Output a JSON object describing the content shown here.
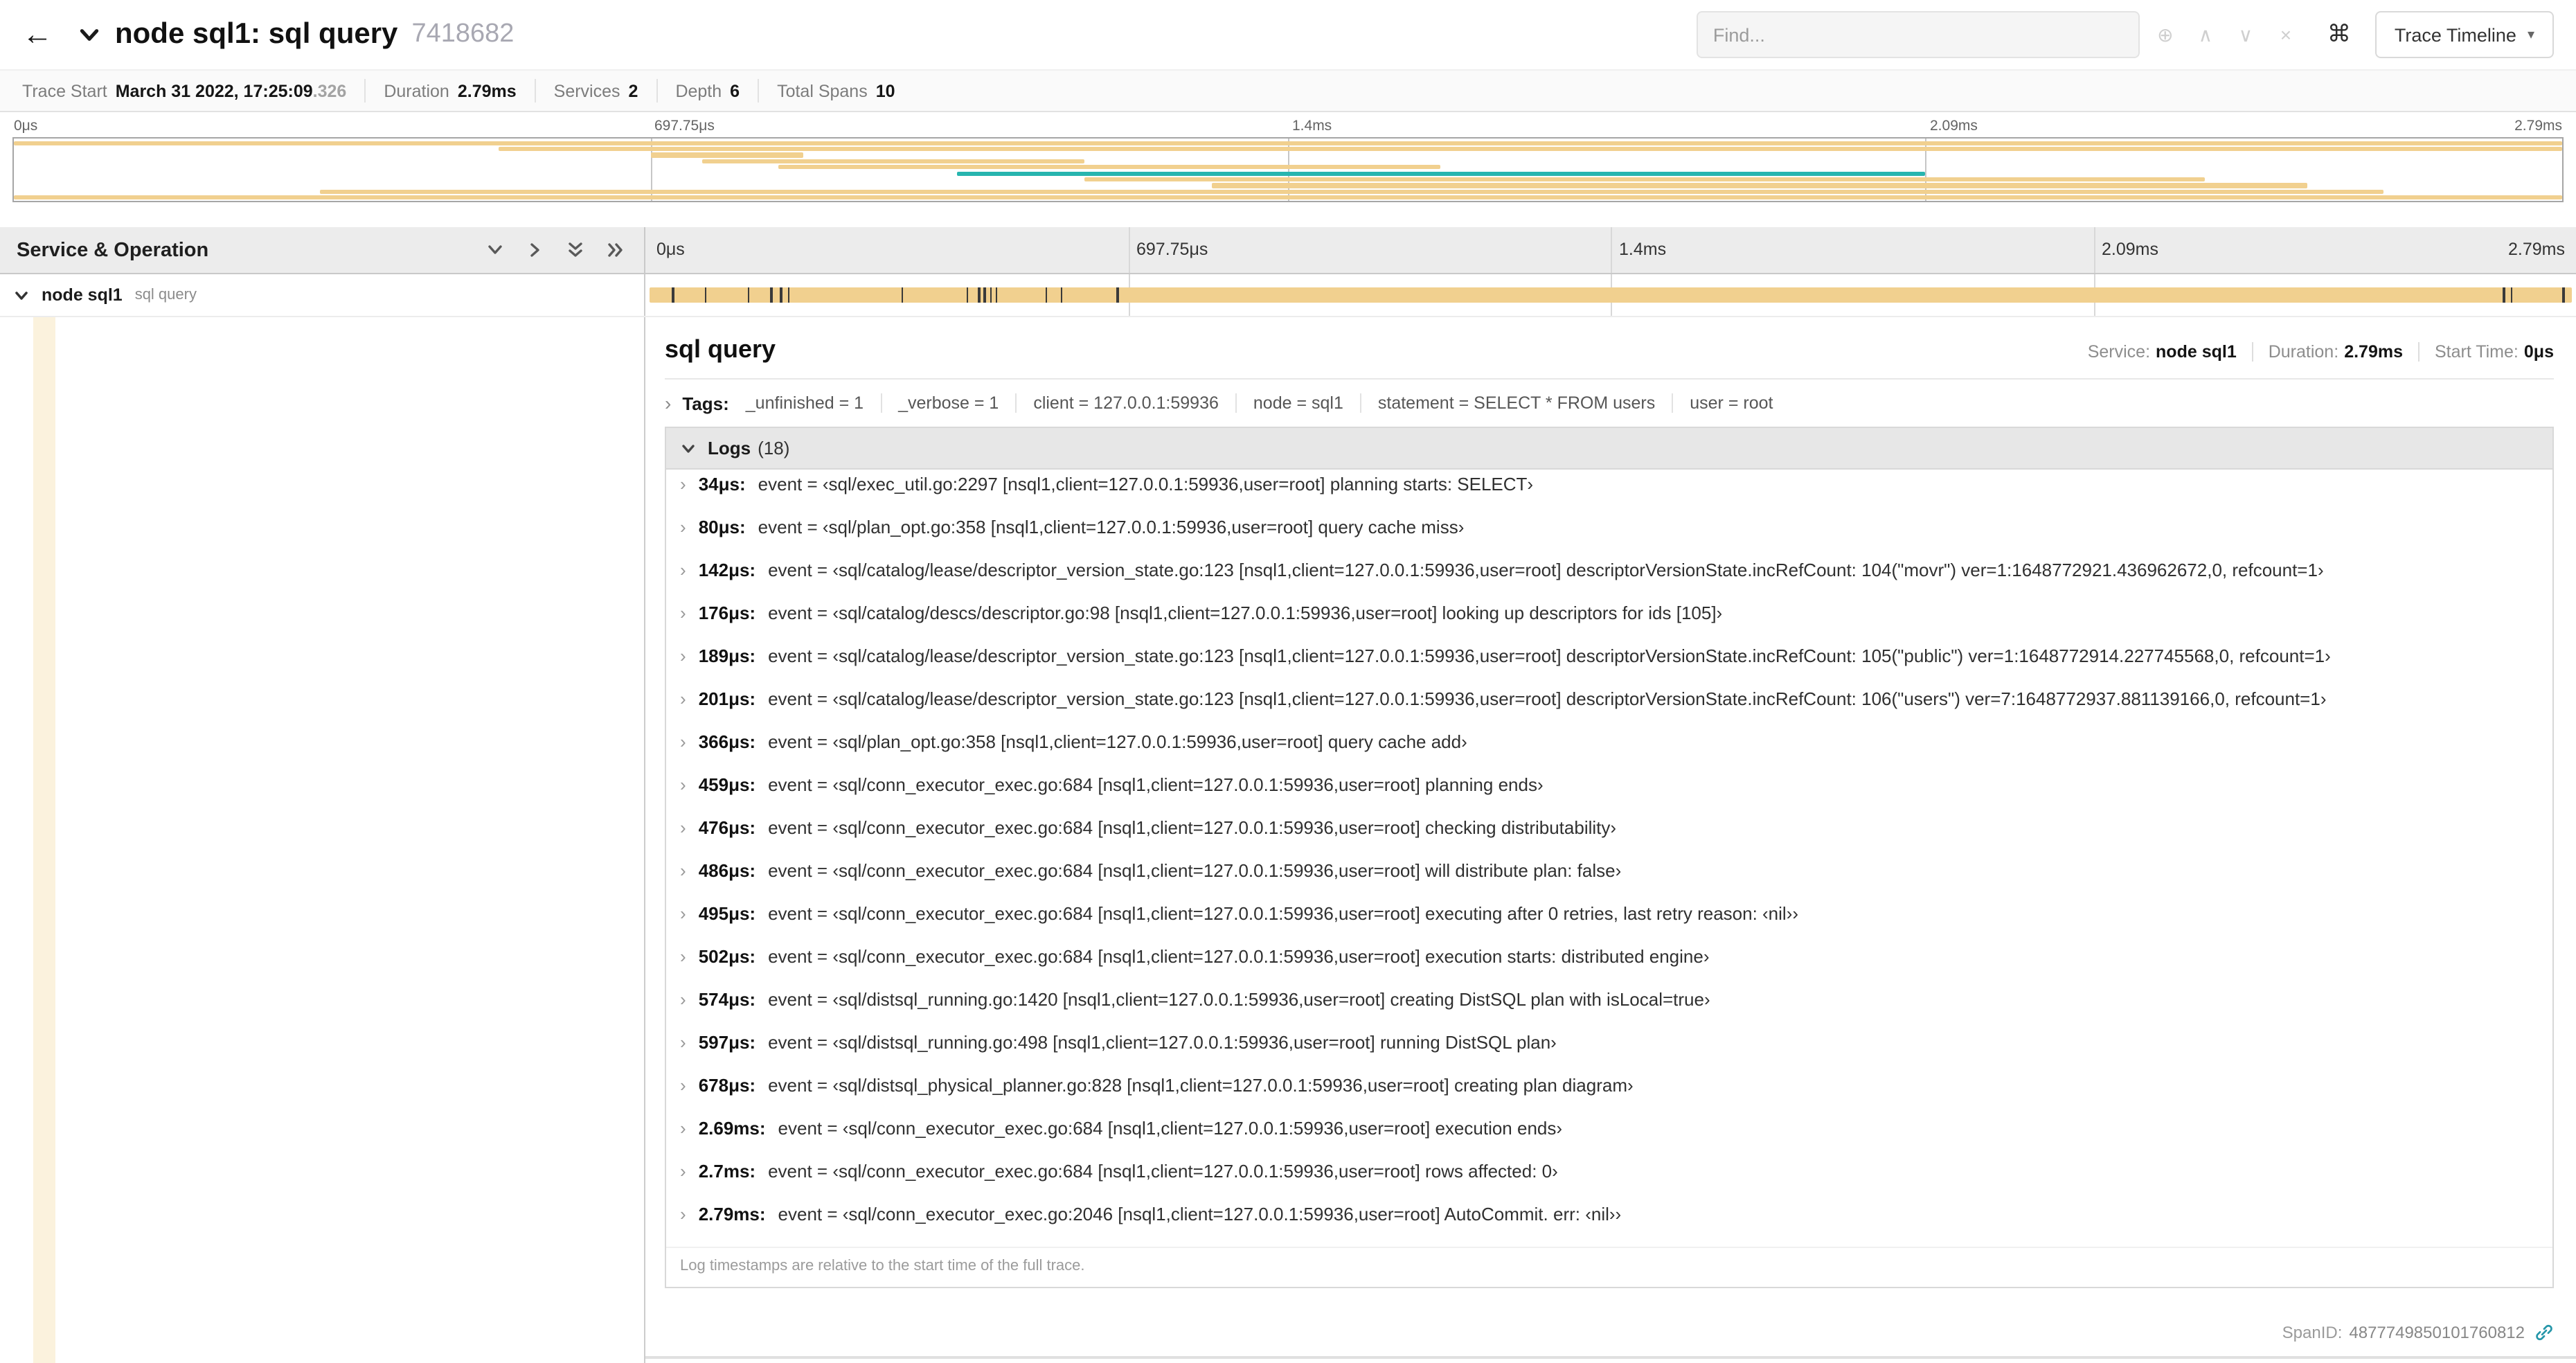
{
  "header": {
    "title": "node sql1: sql query",
    "trace_id": "7418682",
    "find_placeholder": "Find...",
    "view_button": "Trace Timeline"
  },
  "icons": {
    "back_arrow": "←",
    "zoom": "⊕",
    "prev": "∧",
    "next": "∨",
    "clear": "×",
    "command": "⌘",
    "caret_down": "▾",
    "chevron_right": "›"
  },
  "trace_info": {
    "trace_start_label": "Trace Start",
    "trace_start_value": "March 31 2022, 17:25:09",
    "trace_start_fraction": ".326",
    "duration_label": "Duration",
    "duration_value": "2.79ms",
    "services_label": "Services",
    "services_value": "2",
    "depth_label": "Depth",
    "depth_value": "6",
    "total_spans_label": "Total Spans",
    "total_spans_value": "10"
  },
  "colors": {
    "tan": "#F1D08F",
    "teal": "#27B5AF",
    "strip": "#FBF2DD"
  },
  "minimap": {
    "ticks": [
      "0μs",
      "697.75μs",
      "1.4ms",
      "2.09ms",
      "2.79ms"
    ],
    "spans": [
      {
        "row": 0,
        "start": 0,
        "end": 100,
        "color": "tan"
      },
      {
        "row": 1,
        "start": 19,
        "end": 100,
        "color": "tan"
      },
      {
        "row": 2,
        "start": 25,
        "end": 31,
        "color": "tan"
      },
      {
        "row": 3,
        "start": 27,
        "end": 42,
        "color": "tan"
      },
      {
        "row": 4,
        "start": 30,
        "end": 56,
        "color": "tan"
      },
      {
        "row": 5,
        "start": 37,
        "end": 75,
        "color": "teal"
      },
      {
        "row": 6,
        "start": 42,
        "end": 86,
        "color": "tan"
      },
      {
        "row": 7,
        "start": 47,
        "end": 90,
        "color": "tan"
      },
      {
        "row": 8,
        "start": 12,
        "end": 93,
        "color": "tan"
      },
      {
        "row": 9,
        "start": 0,
        "end": 100,
        "color": "tan"
      }
    ]
  },
  "timeline": {
    "left_header": "Service & Operation",
    "ticks": [
      "0μs",
      "697.75μs",
      "1.4ms",
      "2.09ms",
      "2.79ms"
    ],
    "row": {
      "service": "node sql1",
      "operation": "sql query",
      "bar_start": 0.2,
      "bar_end": 99.8,
      "log_ticks_pct": [
        1.2,
        2.9,
        5.1,
        6.3,
        6.8,
        7.2,
        13.1,
        16.5,
        17.1,
        17.4,
        17.7,
        18.0,
        20.6,
        21.4,
        24.3,
        96.4,
        96.8,
        99.5
      ]
    }
  },
  "detail": {
    "title": "sql query",
    "meta": {
      "service_label": "Service:",
      "service_value": "node sql1",
      "duration_label": "Duration:",
      "duration_value": "2.79ms",
      "start_label": "Start Time:",
      "start_value": "0μs"
    },
    "tags_label": "Tags:",
    "tags": [
      "_unfinished = 1",
      "_verbose = 1",
      "client = 127.0.0.1:59936",
      "node = sql1",
      "statement = SELECT * FROM users",
      "user = root"
    ],
    "logs_label": "Logs",
    "logs_count": "(18)",
    "logs": [
      {
        "time": "34μs:",
        "text": "event = ‹sql/exec_util.go:2297 [nsql1,client=127.0.0.1:59936,user=root] planning starts: SELECT›"
      },
      {
        "time": "80μs:",
        "text": "event = ‹sql/plan_opt.go:358 [nsql1,client=127.0.0.1:59936,user=root] query cache miss›"
      },
      {
        "time": "142μs:",
        "text": "event = ‹sql/catalog/lease/descriptor_version_state.go:123 [nsql1,client=127.0.0.1:59936,user=root] descriptorVersionState.incRefCount: 104(\"movr\") ver=1:1648772921.436962672,0, refcount=1›"
      },
      {
        "time": "176μs:",
        "text": "event = ‹sql/catalog/descs/descriptor.go:98 [nsql1,client=127.0.0.1:59936,user=root] looking up descriptors for ids [105]›"
      },
      {
        "time": "189μs:",
        "text": "event = ‹sql/catalog/lease/descriptor_version_state.go:123 [nsql1,client=127.0.0.1:59936,user=root] descriptorVersionState.incRefCount: 105(\"public\") ver=1:1648772914.227745568,0, refcount=1›"
      },
      {
        "time": "201μs:",
        "text": "event = ‹sql/catalog/lease/descriptor_version_state.go:123 [nsql1,client=127.0.0.1:59936,user=root] descriptorVersionState.incRefCount: 106(\"users\") ver=7:1648772937.881139166,0, refcount=1›"
      },
      {
        "time": "366μs:",
        "text": "event = ‹sql/plan_opt.go:358 [nsql1,client=127.0.0.1:59936,user=root] query cache add›"
      },
      {
        "time": "459μs:",
        "text": "event = ‹sql/conn_executor_exec.go:684 [nsql1,client=127.0.0.1:59936,user=root] planning ends›"
      },
      {
        "time": "476μs:",
        "text": "event = ‹sql/conn_executor_exec.go:684 [nsql1,client=127.0.0.1:59936,user=root] checking distributability›"
      },
      {
        "time": "486μs:",
        "text": "event = ‹sql/conn_executor_exec.go:684 [nsql1,client=127.0.0.1:59936,user=root] will distribute plan: false›"
      },
      {
        "time": "495μs:",
        "text": "event = ‹sql/conn_executor_exec.go:684 [nsql1,client=127.0.0.1:59936,user=root] executing after 0 retries, last retry reason: ‹nil››"
      },
      {
        "time": "502μs:",
        "text": "event = ‹sql/conn_executor_exec.go:684 [nsql1,client=127.0.0.1:59936,user=root] execution starts: distributed engine›"
      },
      {
        "time": "574μs:",
        "text": "event = ‹sql/distsql_running.go:1420 [nsql1,client=127.0.0.1:59936,user=root] creating DistSQL plan with isLocal=true›"
      },
      {
        "time": "597μs:",
        "text": "event = ‹sql/distsql_running.go:498 [nsql1,client=127.0.0.1:59936,user=root] running DistSQL plan›"
      },
      {
        "time": "678μs:",
        "text": "event = ‹sql/distsql_physical_planner.go:828 [nsql1,client=127.0.0.1:59936,user=root] creating plan diagram›"
      },
      {
        "time": "2.69ms:",
        "text": "event = ‹sql/conn_executor_exec.go:684 [nsql1,client=127.0.0.1:59936,user=root] execution ends›"
      },
      {
        "time": "2.7ms:",
        "text": "event = ‹sql/conn_executor_exec.go:684 [nsql1,client=127.0.0.1:59936,user=root] rows affected: 0›"
      },
      {
        "time": "2.79ms:",
        "text": "event = ‹sql/conn_executor_exec.go:2046 [nsql1,client=127.0.0.1:59936,user=root] AutoCommit. err: ‹nil››"
      }
    ],
    "footnote": "Log timestamps are relative to the start time of the full trace.",
    "spanid_label": "SpanID:",
    "spanid_value": "4877749850101760812"
  }
}
